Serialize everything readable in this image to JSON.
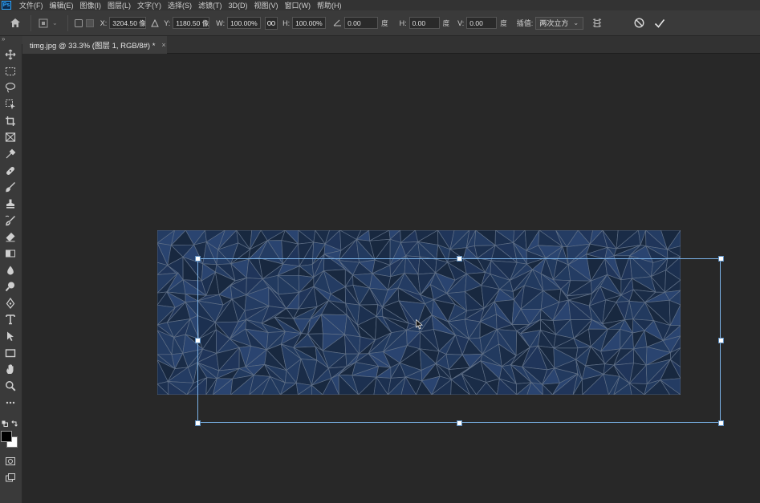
{
  "app": {
    "logo_text": "Ps"
  },
  "menu": [
    "文件(F)",
    "编辑(E)",
    "图像(I)",
    "图层(L)",
    "文字(Y)",
    "选择(S)",
    "滤镜(T)",
    "3D(D)",
    "视图(V)",
    "窗口(W)",
    "帮助(H)"
  ],
  "options": {
    "x_label": "X:",
    "x_value": "3204.50 像",
    "y_label": "Y:",
    "y_value": "1180.50 像",
    "w_label": "W:",
    "w_value": "100.00%",
    "h_label": "H:",
    "h_value": "100.00%",
    "angle_value": "0.00",
    "angle_unit": "度",
    "hskew_label": "H:",
    "hskew_value": "0.00",
    "hskew_unit": "度",
    "vskew_label": "V:",
    "vskew_value": "0.00",
    "vskew_unit": "度",
    "interp_label": "插值:",
    "interp_value": "两次立方"
  },
  "panel_collapse": "»",
  "document": {
    "tab_title": "timg.jpg @ 33.3% (图层 1, RGB/8#) *",
    "close_glyph": "×"
  },
  "tools": [
    "move-tool",
    "marquee-tool",
    "lasso-tool",
    "object-select-tool",
    "crop-tool",
    "frame-tool",
    "eyedropper-tool",
    "healing-tool",
    "brush-tool",
    "stamp-tool",
    "history-brush-tool",
    "eraser-tool",
    "gradient-tool",
    "blur-tool",
    "dodge-tool",
    "pen-tool",
    "type-tool",
    "path-select-tool",
    "rectangle-tool",
    "hand-tool",
    "zoom-tool",
    "more-tools"
  ],
  "colors": {
    "foreground": "#000000",
    "background": "#ffffff",
    "accent": "#7ab2e8",
    "image_base": "#1d2f4a"
  }
}
